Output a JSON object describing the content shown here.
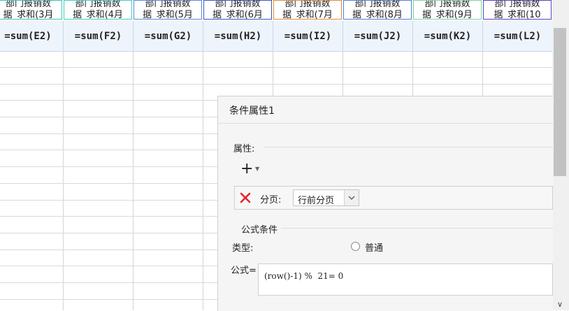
{
  "header_top": [
    {
      "line1": "部门报销数",
      "line2": "据_求和(3月",
      "color": "#39c6b4"
    },
    {
      "line1": "部门报销数",
      "line2": "据_求和(4月",
      "color": "#3dd0bf"
    },
    {
      "line1": "部门报销数",
      "line2": "据_求和(5月",
      "color": "#5a86d8"
    },
    {
      "line1": "部门报销数",
      "line2": "据_求和(6月",
      "color": "#3c56c9"
    },
    {
      "line1": "部门报销数",
      "line2": "据_求和(7月",
      "color": "#e2893a"
    },
    {
      "line1": "部门报销数",
      "line2": "据_求和(8月",
      "color": "#4f80d8"
    },
    {
      "line1": "部门报销数",
      "line2": "据_求和(9月",
      "color": "#7bd6a0"
    },
    {
      "line1": "部门报销数",
      "line2": "据_求和(10",
      "color": "#5342c8"
    }
  ],
  "formula_row": [
    "=sum(E2)",
    "=sum(F2)",
    "=sum(G2)",
    "=sum(H2)",
    "=sum(I2)",
    "=sum(J2)",
    "=sum(K2)",
    "=sum(L2)"
  ],
  "panel": {
    "title": "条件属性1",
    "properties_label": "属性:",
    "add_icon": "plus-icon",
    "property_row": {
      "delete_icon": "close-icon",
      "label": "分页:",
      "select_value": "行前分页"
    },
    "formula_condition_label": "公式条件",
    "type_label": "类型:",
    "radio_label": "普通",
    "formula_label": "公式=",
    "formula_value": "(row()-1) %  21= 0"
  }
}
